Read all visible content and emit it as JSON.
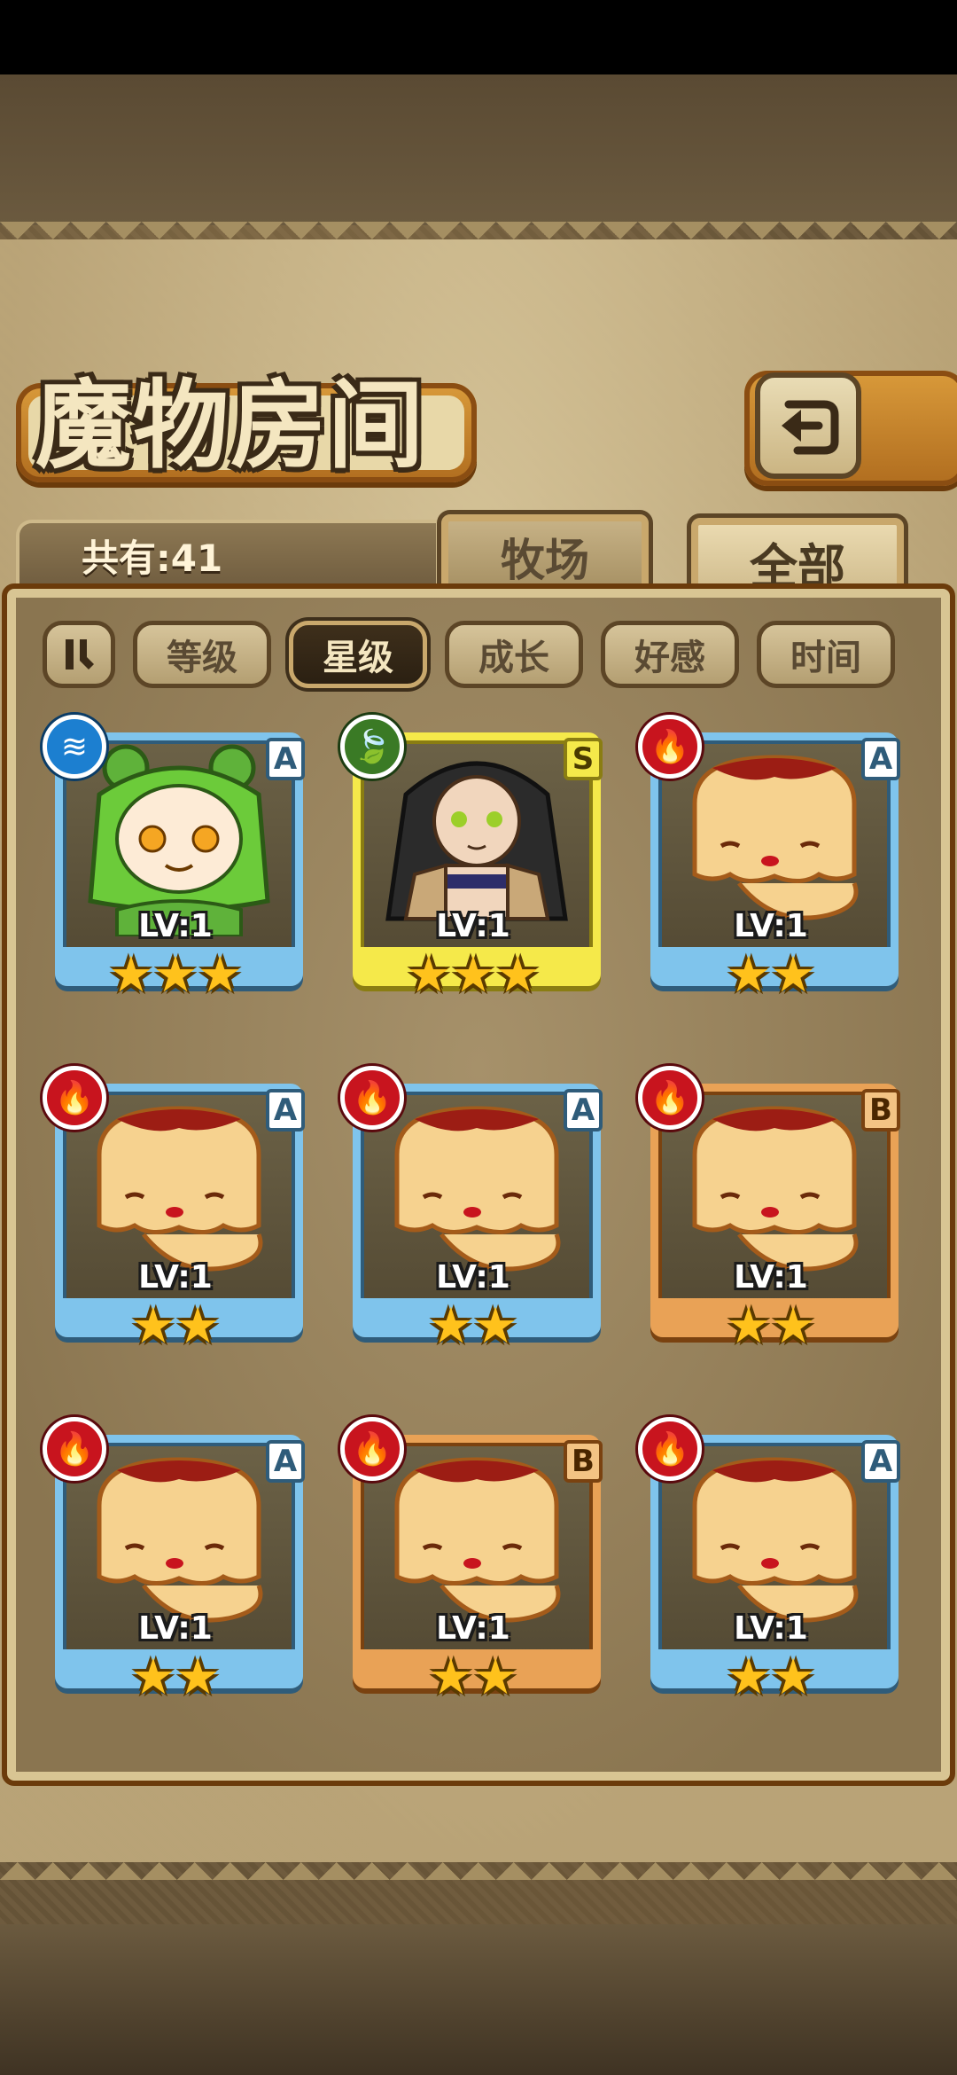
{
  "title": "魔物房间",
  "count_label": "共有:41",
  "tabs": [
    {
      "label": "牧场",
      "active": false
    },
    {
      "label": "全部",
      "active": true
    }
  ],
  "filters": [
    {
      "label": "等级",
      "active": false
    },
    {
      "label": "星级",
      "active": true
    },
    {
      "label": "成长",
      "active": false
    },
    {
      "label": "好感",
      "active": false
    },
    {
      "label": "时间",
      "active": false
    }
  ],
  "sort_icon": "sort-toggle-icon",
  "back_icon": "back-arrow-icon",
  "monsters": [
    {
      "element": "water",
      "rank": "A",
      "level": "LV:1",
      "stars": "★★★",
      "portrait": "frog-girl"
    },
    {
      "element": "wood",
      "rank": "S",
      "level": "LV:1",
      "stars": "★★★",
      "portrait": "dark-hair-girl"
    },
    {
      "element": "fire",
      "rank": "A",
      "level": "LV:1",
      "stars": "★★",
      "portrait": "pudding"
    },
    {
      "element": "fire",
      "rank": "A",
      "level": "LV:1",
      "stars": "★★",
      "portrait": "pudding"
    },
    {
      "element": "fire",
      "rank": "A",
      "level": "LV:1",
      "stars": "★★",
      "portrait": "pudding"
    },
    {
      "element": "fire",
      "rank": "B",
      "level": "LV:1",
      "stars": "★★",
      "portrait": "pudding"
    },
    {
      "element": "fire",
      "rank": "A",
      "level": "LV:1",
      "stars": "★★",
      "portrait": "pudding"
    },
    {
      "element": "fire",
      "rank": "B",
      "level": "LV:1",
      "stars": "★★",
      "portrait": "pudding"
    },
    {
      "element": "fire",
      "rank": "A",
      "level": "LV:1",
      "stars": "★★",
      "portrait": "pudding"
    }
  ],
  "colors": {
    "rank_A": "#7fc4ec",
    "rank_S": "#f5e94a",
    "rank_B": "#e9a256",
    "fire": "#c8141e",
    "water": "#1c7fd0",
    "wood": "#3a7a25"
  }
}
